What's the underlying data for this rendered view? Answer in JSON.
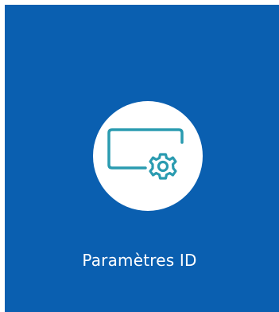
{
  "tile": {
    "label": "Paramètres ID",
    "icon": "display-settings-icon",
    "background_color": "#0a5fb0",
    "icon_color": "#2a9bb0"
  }
}
